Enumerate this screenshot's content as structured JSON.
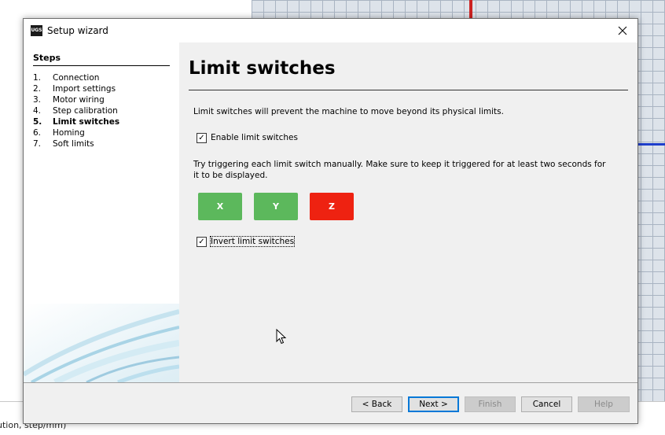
{
  "background": {
    "line1": "ution, step/mm)"
  },
  "dialog": {
    "logo": "UGS",
    "title": "Setup wizard",
    "close_icon": "close-icon"
  },
  "sidebar": {
    "heading": "Steps",
    "steps": [
      {
        "num": "1.",
        "label": "Connection"
      },
      {
        "num": "2.",
        "label": "Import settings"
      },
      {
        "num": "3.",
        "label": "Motor wiring"
      },
      {
        "num": "4.",
        "label": "Step calibration"
      },
      {
        "num": "5.",
        "label": "Limit switches"
      },
      {
        "num": "6.",
        "label": "Homing"
      },
      {
        "num": "7.",
        "label": "Soft limits"
      }
    ],
    "active_index": 4
  },
  "content": {
    "title": "Limit switches",
    "description": "Limit switches will prevent the machine to move beyond its physical limits.",
    "enable_checkbox": {
      "label": "Enable limit switches",
      "checked": true
    },
    "trigger_text": "Try triggering each limit switch manually. Make sure to keep it triggered for at least two seconds for it to be displayed.",
    "axes": [
      {
        "label": "X",
        "color": "#5cb85c"
      },
      {
        "label": "Y",
        "color": "#5cb85c"
      },
      {
        "label": "Z",
        "color": "#ee2211"
      }
    ],
    "invert_checkbox": {
      "label": "Invert limit switches",
      "checked": true
    }
  },
  "footer": {
    "back": "< Back",
    "next": "Next >",
    "finish": "Finish",
    "cancel": "Cancel",
    "help": "Help"
  }
}
